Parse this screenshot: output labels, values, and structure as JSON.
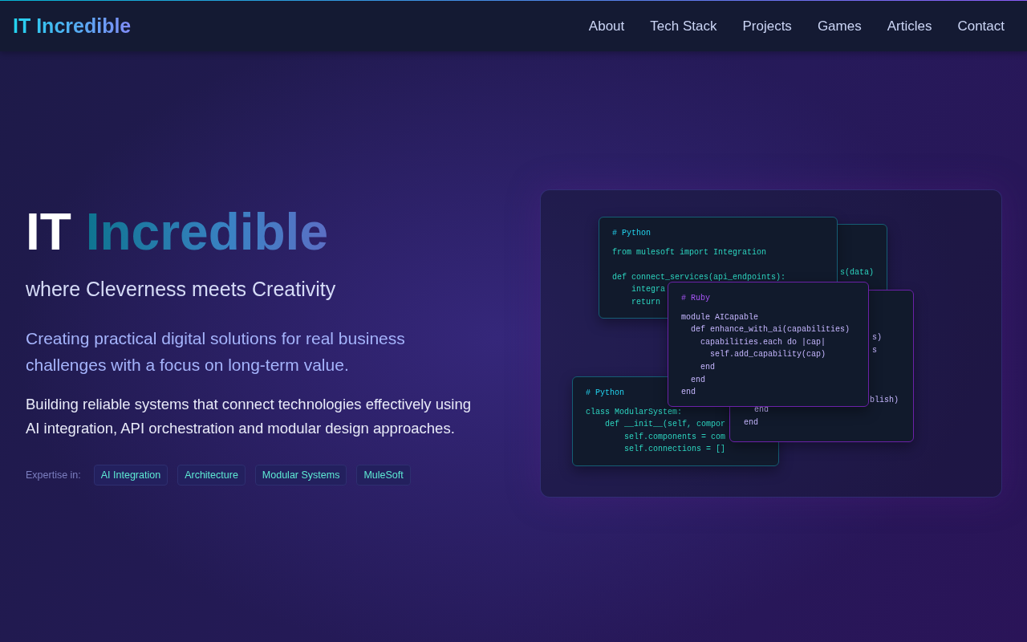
{
  "nav": {
    "logo": "IT Incredible",
    "links": [
      {
        "label": "About"
      },
      {
        "label": "Tech Stack"
      },
      {
        "label": "Projects"
      },
      {
        "label": "Games"
      },
      {
        "label": "Articles"
      },
      {
        "label": "Contact"
      }
    ]
  },
  "hero": {
    "title_lead": "IT",
    "title_accent": "Incredible",
    "tagline": "where Cleverness meets Creativity",
    "lead": "Creating practical digital solutions for real business challenges with a focus on long-term value.",
    "body": "Building reliable systems that connect technologies effectively using AI integration, API orchestration and modular design approaches.",
    "expertise_label": "Expertise in:",
    "tags": [
      "AI Integration",
      "Architecture",
      "Modular Systems",
      "MuleSoft"
    ]
  },
  "code_cards": [
    {
      "kind": "python",
      "lines": [
        "s(data)"
      ]
    },
    {
      "kind": "python",
      "lines": [
        "# Python",
        "class ModularSystem:",
        "    def __init__(self, compor",
        "        self.components = com",
        "        self.connections = []"
      ]
    },
    {
      "kind": "ruby",
      "lines": [
        "s)",
        "s",
        "blish)",
        "end",
        "end"
      ]
    },
    {
      "kind": "python",
      "lines": [
        "# Python",
        "from mulesoft import Integration",
        "def connect_services(api_endpoints):",
        "    integra",
        "    return"
      ]
    },
    {
      "kind": "ruby",
      "lines": [
        "# Ruby",
        "module AICapable",
        "  def enhance_with_ai(capabilities)",
        "    capabilities.each do |cap|",
        "      self.add_capability(cap)",
        "    end",
        "  end",
        "end"
      ]
    }
  ]
}
